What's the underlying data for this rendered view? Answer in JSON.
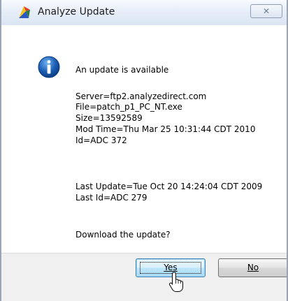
{
  "window": {
    "title": "Analyze Update",
    "close_glyph": "✕"
  },
  "message": {
    "heading": "An update is available",
    "server": "Server=ftp2.analyzedirect.com",
    "file": "File=patch_p1_PC_NT.exe",
    "size": "Size=13592589",
    "mod_time": "Mod Time=Thu Mar 25 10:31:44 CDT 2010",
    "id": "Id=ADC 372",
    "last_update": "Last Update=Tue Oct 20 14:24:04 CDT 2009",
    "last_id": "Last Id=ADC 279",
    "question": "Download the update?"
  },
  "buttons": {
    "yes": "Yes",
    "no": "No"
  },
  "icons": {
    "app": "app-icon",
    "info": "info-icon",
    "cursor": "mouse-cursor-icon"
  },
  "colors": {
    "info_blue": "#1c5fb4",
    "default_button_border": "#3c7fb1"
  }
}
